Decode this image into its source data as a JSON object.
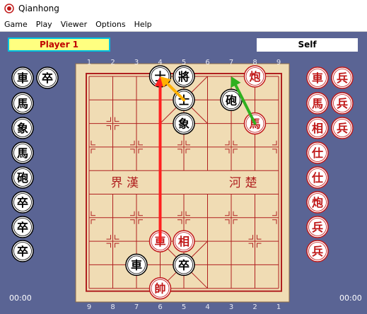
{
  "app": {
    "title": "Qianhong"
  },
  "menu": [
    "Game",
    "Play",
    "Viewer",
    "Options",
    "Help"
  ],
  "players": {
    "top_left": "Player 1",
    "top_right": "Self"
  },
  "timers": {
    "left": "00:00",
    "right": "00:00"
  },
  "files_top": [
    "1",
    "2",
    "3",
    "4",
    "5",
    "6",
    "7",
    "8",
    "9"
  ],
  "files_bottom": [
    "9",
    "8",
    "7",
    "6",
    "5",
    "4",
    "3",
    "2",
    "1"
  ],
  "river": {
    "left": "界  漢",
    "right": "河  楚"
  },
  "board_pieces": [
    {
      "col": 3,
      "row": 0,
      "char": "士",
      "side": "black"
    },
    {
      "col": 4,
      "row": 0,
      "char": "將",
      "side": "black"
    },
    {
      "col": 7,
      "row": 0,
      "char": "炮",
      "side": "red"
    },
    {
      "col": 4,
      "row": 1,
      "char": "士",
      "side": "black"
    },
    {
      "col": 6,
      "row": 1,
      "char": "砲",
      "side": "black"
    },
    {
      "col": 4,
      "row": 2,
      "char": "象",
      "side": "black"
    },
    {
      "col": 7,
      "row": 2,
      "char": "馬",
      "side": "red"
    },
    {
      "col": 3,
      "row": 7,
      "char": "車",
      "side": "red"
    },
    {
      "col": 4,
      "row": 7,
      "char": "相",
      "side": "red"
    },
    {
      "col": 2,
      "row": 8,
      "char": "車",
      "side": "black"
    },
    {
      "col": 4,
      "row": 8,
      "char": "卒",
      "side": "black"
    },
    {
      "col": 3,
      "row": 9,
      "char": "帥",
      "side": "red"
    }
  ],
  "captured_left": [
    {
      "char": "車",
      "side": "black"
    },
    {
      "char": "卒",
      "side": "black"
    },
    {
      "char": "馬",
      "side": "black"
    },
    {
      "char": "象",
      "side": "black"
    },
    {
      "char": "馬",
      "side": "black"
    },
    {
      "char": "砲",
      "side": "black"
    },
    {
      "char": "卒",
      "side": "black"
    },
    {
      "char": "卒",
      "side": "black"
    },
    {
      "char": "卒",
      "side": "black"
    }
  ],
  "captured_right": [
    {
      "char": "車",
      "side": "red"
    },
    {
      "char": "兵",
      "side": "red"
    },
    {
      "char": "馬",
      "side": "red"
    },
    {
      "char": "兵",
      "side": "red"
    },
    {
      "char": "相",
      "side": "red"
    },
    {
      "char": "兵",
      "side": "red"
    },
    {
      "char": "仕",
      "side": "red"
    },
    {
      "char": "仕",
      "side": "red"
    },
    {
      "char": "炮",
      "side": "red"
    },
    {
      "char": "兵",
      "side": "red"
    },
    {
      "char": "兵",
      "side": "red"
    }
  ],
  "arrows": [
    {
      "from": [
        3,
        7
      ],
      "to": [
        3,
        0
      ],
      "color": "#ff2020"
    },
    {
      "from": [
        4,
        1
      ],
      "to": [
        3,
        0
      ],
      "color": "#ffb000"
    },
    {
      "from": [
        7,
        2
      ],
      "to": [
        6,
        0
      ],
      "color": "#30b020"
    }
  ],
  "colors": {
    "red_piece": "#c01818",
    "black_piece": "#000000",
    "board": "#f0dcb4",
    "line": "#b02020"
  }
}
